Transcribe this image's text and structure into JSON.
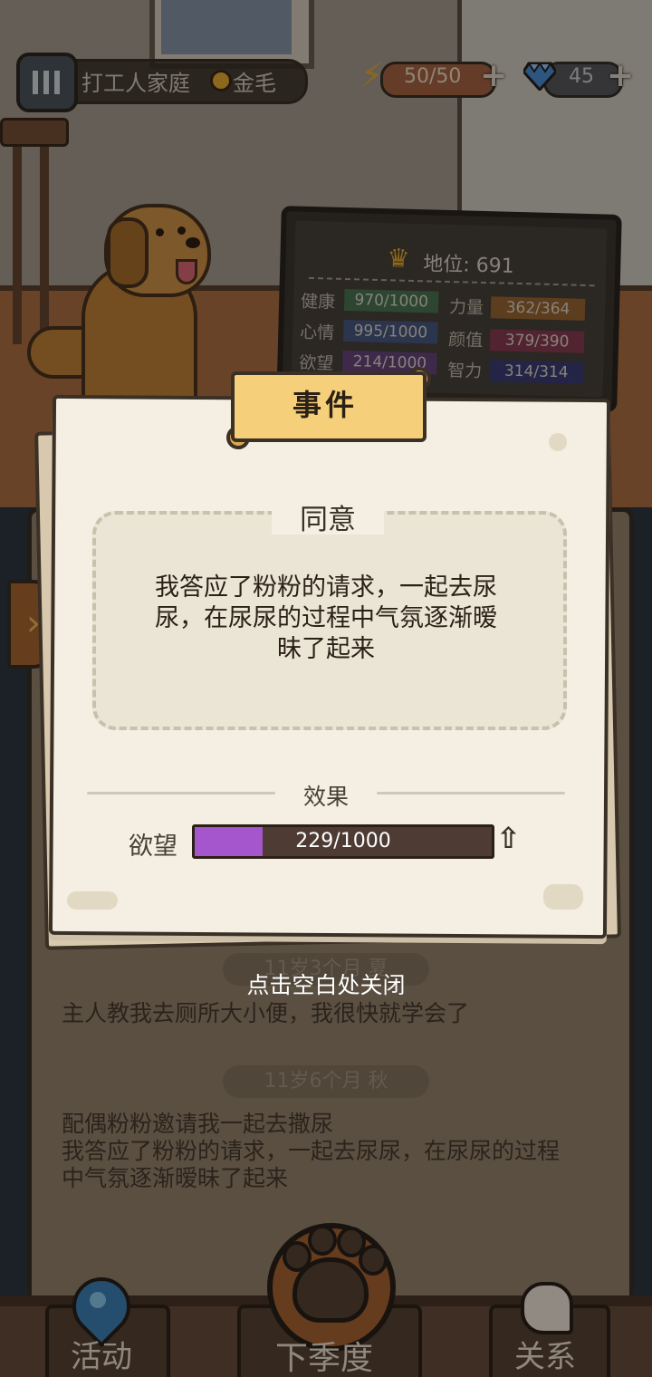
{
  "top_bar": {
    "family": "打工人家庭",
    "breed": "金毛",
    "energy": "50/50",
    "gems": "45"
  },
  "status_board": {
    "status_label": "地位: 691",
    "stats": [
      {
        "label": "健康",
        "value": "970/1000",
        "color": "#3c6b4a"
      },
      {
        "label": "力量",
        "value": "362/364",
        "color": "#8d5e2a"
      },
      {
        "label": "心情",
        "value": "995/1000",
        "color": "#3a4f7a"
      },
      {
        "label": "颜值",
        "value": "379/390",
        "color": "#7d2f4a"
      },
      {
        "label": "欲望",
        "value": "214/1000",
        "color": "#5c3a78"
      },
      {
        "label": "智力",
        "value": "314/314",
        "color": "#2d336e"
      }
    ]
  },
  "event_dialog": {
    "header": "事件",
    "choice": "同意",
    "story_lines": [
      "我答应了粉粉的请求，一起去尿",
      "尿，在尿尿的过程中气氛逐渐暧",
      "昧了起来"
    ],
    "effect_label": "效果",
    "effect": {
      "stat": "欲望",
      "value_text": "229/1000",
      "fraction": 0.229,
      "fill_color": "#a556cc",
      "trend": "up"
    }
  },
  "close_hint": "点击空白处关闭",
  "log": {
    "entries": [
      {
        "time": "11岁3个月 夏",
        "lines": [
          "主人教我去厕所大小便，我很快就学会了"
        ]
      },
      {
        "time": "11岁6个月 秋",
        "lines": [
          "配偶粉粉邀请我一起去撒尿",
          "我答应了粉粉的请求，一起去尿尿，在尿尿的过程",
          "中气氛逐渐暧昧了起来"
        ]
      }
    ]
  },
  "bottom_nav": {
    "activity": "活动",
    "next_season": "下季度",
    "relations": "关系"
  },
  "icons": [
    "family-icon",
    "medal-icon",
    "lightning-icon",
    "gem-icon",
    "plus-icon",
    "crown-icon",
    "chevron-right-icon",
    "up-arrow-icon",
    "location-pin-icon",
    "paw-icon",
    "relation-icon"
  ]
}
